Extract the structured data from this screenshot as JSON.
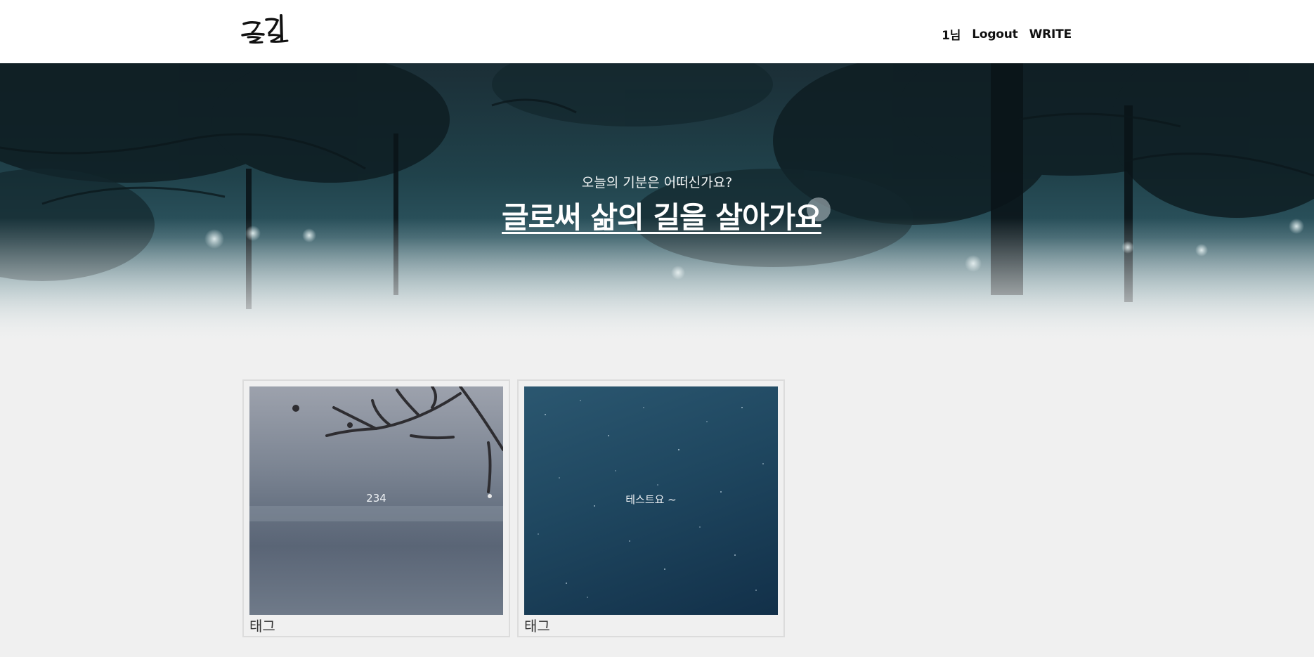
{
  "header": {
    "logo_text": "글길",
    "nav": {
      "user_label": "1님",
      "logout_label": "Logout",
      "write_label": "WRITE"
    }
  },
  "hero": {
    "subtitle": "오늘의 기분은 어떠신가요?",
    "title": "글로써 삶의 길을 살아가요"
  },
  "posts": [
    {
      "title": "234",
      "tag": "태그"
    },
    {
      "title": "테스트요 ~",
      "tag": "태그"
    }
  ],
  "colors": {
    "header_bg": "#ffffff",
    "page_bg": "#f0f0f0",
    "hero_dark": "#1b2e36",
    "text_dark": "#111111"
  }
}
